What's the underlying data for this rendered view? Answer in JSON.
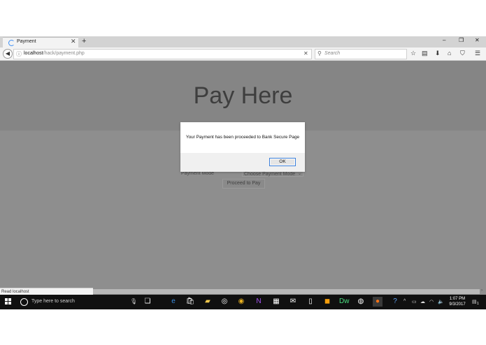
{
  "browser": {
    "tab_title": "Payment",
    "tab_close": "✕",
    "new_tab": "+",
    "window_controls": {
      "minimize": "–",
      "restore": "❐",
      "close": "✕"
    },
    "url_host": "localhost",
    "url_path": "/hack/payment.php",
    "url_clear": "✕",
    "search_placeholder": "Search",
    "toolbar_icons": [
      "star-icon",
      "clipboard-icon",
      "download-icon",
      "home-icon",
      "pocket-icon",
      "menu-icon"
    ]
  },
  "page": {
    "title": "Pay Here",
    "payment_mode_label": "Payment Mode",
    "payment_mode_select": "Choose Payment Mode",
    "proceed_button": "Proceed to Pay"
  },
  "dialog": {
    "message": "Your Payment has been proceeded to Bank Secure Page",
    "ok_label": "OK"
  },
  "status_bar": {
    "text": "Read localhost"
  },
  "taskbar": {
    "search_text": "Type here to search",
    "time": "1:07 PM",
    "date": "9/3/2017",
    "notification_count": "1"
  },
  "colors": {
    "overlay": "#8e8e8e",
    "accent": "#3c7fd9",
    "taskbar": "#101010"
  }
}
